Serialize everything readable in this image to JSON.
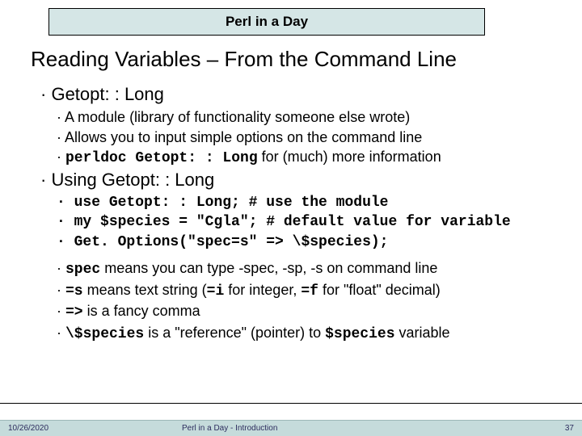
{
  "header": {
    "course_title": "Perl in a Day"
  },
  "slide": {
    "title": "Reading Variables – From the Command Line"
  },
  "sec1": {
    "heading": "Getopt: : Long",
    "b1": "A module (library of functionality someone else wrote)",
    "b2": "Allows you to input simple options on the command line",
    "b3_code": "perldoc Getopt: : Long",
    "b3_rest": " for (much) more information"
  },
  "sec2": {
    "heading": "Using Getopt: : Long",
    "c1": "use Getopt: : Long; # use the module",
    "c2": "my $species = \"Cgla\"; # default value for variable",
    "c3": "Get. Options(\"spec=s\" => \\$species);",
    "e1_code": "spec",
    "e1_rest": " means you can type -spec, -sp, -s on command line",
    "e2_code": "=s",
    "e2_mid": " means text string (",
    "e2_code2": "=i",
    "e2_mid2": " for integer, ",
    "e2_code3": "=f",
    "e2_rest": " for \"float\" decimal)",
    "e3_code": "=>",
    "e3_rest": " is a fancy comma",
    "e4_code": "\\$species",
    "e4_mid": " is a \"reference\" (pointer) to ",
    "e4_code2": "$species",
    "e4_rest": " variable"
  },
  "footer": {
    "date": "10/26/2020",
    "title": "Perl in a Day - Introduction",
    "page": "37"
  }
}
